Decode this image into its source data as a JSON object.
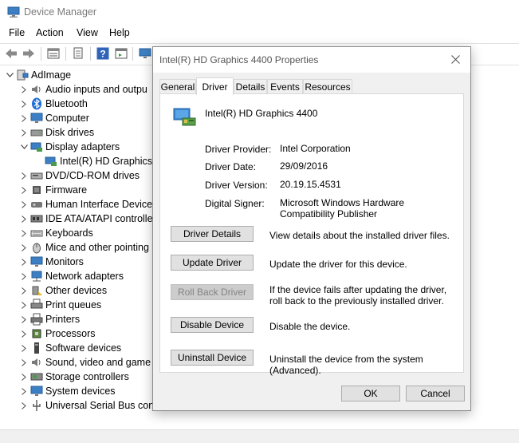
{
  "window": {
    "title": "Device Manager",
    "menu": [
      "File",
      "Action",
      "View",
      "Help"
    ]
  },
  "toolbar": {
    "icons": [
      "back-arrow-icon",
      "forward-arrow-icon",
      "properties-icon",
      "print-icon",
      "help-icon",
      "action-icon",
      "monitor-icon"
    ]
  },
  "tree": {
    "root": "AdImage",
    "items": [
      {
        "label": "Audio inputs and outpu",
        "icon": "audio-icon",
        "expanded": false
      },
      {
        "label": "Bluetooth",
        "icon": "bluetooth-icon",
        "expanded": false
      },
      {
        "label": "Computer",
        "icon": "computer-icon",
        "expanded": false
      },
      {
        "label": "Disk drives",
        "icon": "disk-icon",
        "expanded": false
      },
      {
        "label": "Display adapters",
        "icon": "display-adapter-icon",
        "expanded": true
      },
      {
        "label": "Intel(R) HD Graphics",
        "icon": "display-adapter-icon",
        "child": true
      },
      {
        "label": "DVD/CD-ROM drives",
        "icon": "dvd-icon",
        "expanded": false
      },
      {
        "label": "Firmware",
        "icon": "firmware-icon",
        "expanded": false
      },
      {
        "label": "Human Interface Device",
        "icon": "hid-icon",
        "expanded": false
      },
      {
        "label": "IDE ATA/ATAPI controlle",
        "icon": "ide-icon",
        "expanded": false
      },
      {
        "label": "Keyboards",
        "icon": "keyboard-icon",
        "expanded": false
      },
      {
        "label": "Mice and other pointing",
        "icon": "mouse-icon",
        "expanded": false
      },
      {
        "label": "Monitors",
        "icon": "monitor-icon",
        "expanded": false
      },
      {
        "label": "Network adapters",
        "icon": "network-icon",
        "expanded": false
      },
      {
        "label": "Other devices",
        "icon": "other-devices-icon",
        "expanded": false
      },
      {
        "label": "Print queues",
        "icon": "print-queue-icon",
        "expanded": false
      },
      {
        "label": "Printers",
        "icon": "printer-icon",
        "expanded": false
      },
      {
        "label": "Processors",
        "icon": "processor-icon",
        "expanded": false
      },
      {
        "label": "Software devices",
        "icon": "software-device-icon",
        "expanded": false
      },
      {
        "label": "Sound, video and game",
        "icon": "sound-icon",
        "expanded": false
      },
      {
        "label": "Storage controllers",
        "icon": "storage-icon",
        "expanded": false
      },
      {
        "label": "System devices",
        "icon": "system-icon",
        "expanded": false
      },
      {
        "label": "Universal Serial Bus cont",
        "icon": "usb-icon",
        "expanded": false
      }
    ]
  },
  "dialog": {
    "title": "Intel(R) HD Graphics 4400 Properties",
    "tabs": [
      "General",
      "Driver",
      "Details",
      "Events",
      "Resources"
    ],
    "active_tab": "Driver",
    "device_name": "Intel(R) HD Graphics 4400",
    "properties": [
      {
        "label": "Driver Provider:",
        "value": "Intel Corporation"
      },
      {
        "label": "Driver Date:",
        "value": "29/09/2016"
      },
      {
        "label": "Driver Version:",
        "value": "20.19.15.4531"
      },
      {
        "label": "Digital Signer:",
        "value": "Microsoft Windows Hardware Compatibility Publisher"
      }
    ],
    "actions": [
      {
        "button": "Driver Details",
        "desc": "View details about the installed driver files.",
        "enabled": true
      },
      {
        "button": "Update Driver",
        "desc": "Update the driver for this device.",
        "enabled": true
      },
      {
        "button": "Roll Back Driver",
        "desc": "If the device fails after updating the driver, roll back to the previously installed driver.",
        "enabled": false
      },
      {
        "button": "Disable Device",
        "desc": "Disable the device.",
        "enabled": true
      },
      {
        "button": "Uninstall Device",
        "desc": "Uninstall the device from the system (Advanced).",
        "enabled": true
      }
    ],
    "ok_label": "OK",
    "cancel_label": "Cancel"
  },
  "colors": {
    "accent_blue": "#2b7bd6",
    "dialog_bg": "#f0f0f0",
    "button_bg": "#e1e1e1",
    "button_border": "#adadad"
  }
}
